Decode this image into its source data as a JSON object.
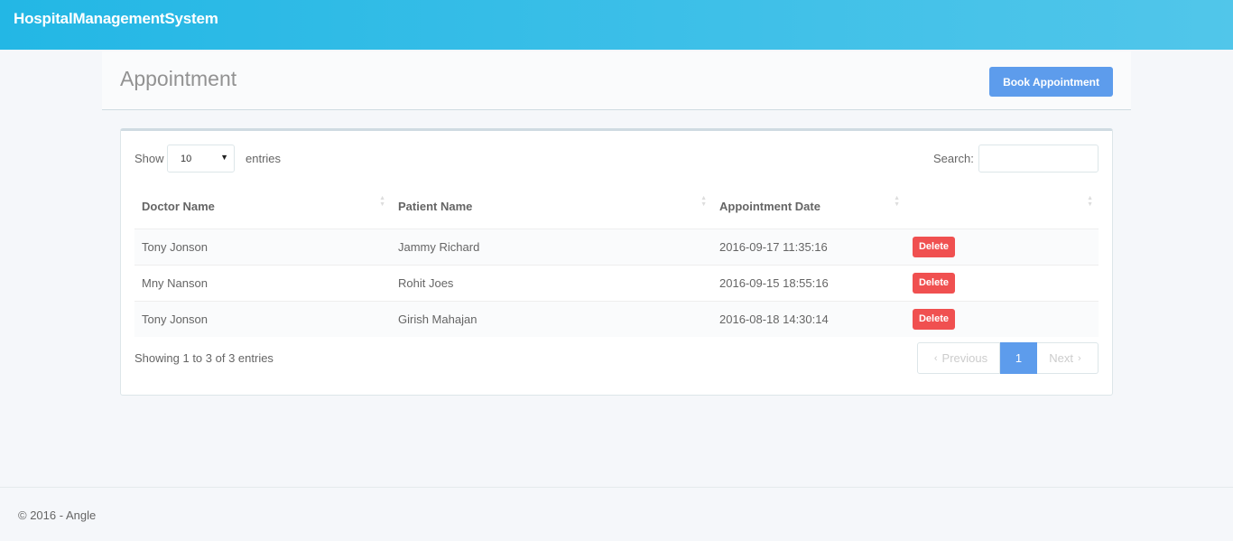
{
  "header": {
    "brand": "HospitalManagementSystem"
  },
  "heading": {
    "title": "Appointment",
    "book_button": "Book Appointment"
  },
  "table_controls": {
    "show_label": "Show",
    "length_value": "10",
    "entries_label": "entries",
    "search_label": "Search:",
    "search_value": ""
  },
  "columns": [
    "Doctor Name",
    "Patient Name",
    "Appointment Date",
    ""
  ],
  "rows": [
    {
      "doctor": "Tony Jonson",
      "patient": "Jammy Richard",
      "date": "2016-09-17 11:35:16",
      "action": "Delete"
    },
    {
      "doctor": "Mny Nanson",
      "patient": "Rohit Joes",
      "date": "2016-09-15 18:55:16",
      "action": "Delete"
    },
    {
      "doctor": "Tony Jonson",
      "patient": "Girish Mahajan",
      "date": "2016-08-18 14:30:14",
      "action": "Delete"
    }
  ],
  "info": "Showing 1 to 3 of 3 entries",
  "pagination": {
    "previous": "Previous",
    "current": "1",
    "next": "Next"
  },
  "footer": {
    "text": "© 2016 - Angle"
  }
}
